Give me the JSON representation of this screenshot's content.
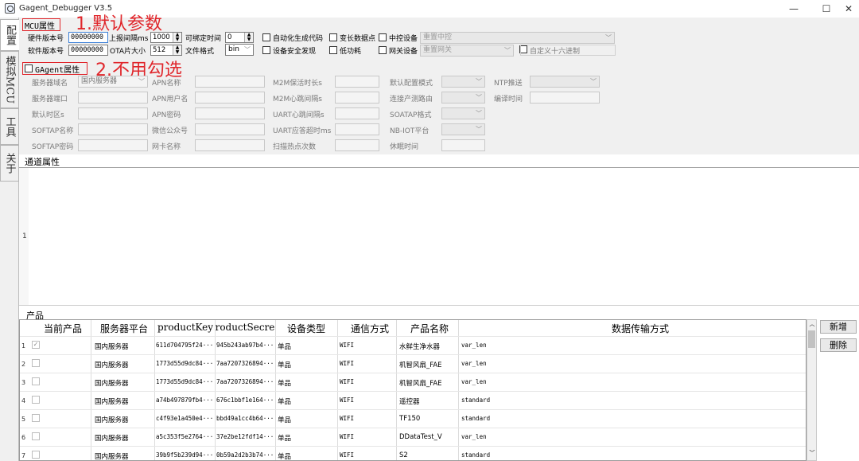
{
  "window": {
    "title": "Gagent_Debugger V3.5",
    "minimize_glyph": "—",
    "maximize_glyph": "☐",
    "close_glyph": "✕"
  },
  "sidebar_tabs": [
    "配置",
    "模拟MCU",
    "工具",
    "关于"
  ],
  "annotations": {
    "step1": "1.默认参数",
    "step2": "2.不用勾选"
  },
  "mcu": {
    "group_title": "MCU属性",
    "hw_version_label": "硬件版本号",
    "hw_version_value": "00000000",
    "sw_version_label": "软件版本号",
    "sw_version_value": "00000000",
    "report_interval_label": "上报间隔ms",
    "report_interval_value": "1000",
    "ota_size_label": "OTA片大小",
    "ota_size_value": "512",
    "bindable_time_label": "可绑定时间",
    "bindable_time_value": "0",
    "file_format_label": "文件格式",
    "file_format_value": "bin",
    "auto_code_label": "自动化生成代码",
    "var_datapoint_label": "变长数据点",
    "central_device_label": "中控设备",
    "central_device_combo": "重置中控",
    "secure_discovery_label": "设备安全发现",
    "low_power_label": "低功耗",
    "gateway_device_label": "网关设备",
    "gateway_combo": "重置网关",
    "custom_hex_label": "自定义十六进制"
  },
  "gagent": {
    "group_title": "GAgent属性",
    "server_domain_label": "服务器域名",
    "server_domain_value": "国内服务器",
    "server_port_label": "服务器端口",
    "default_tz_label": "默认时区s",
    "softap_name_label": "SOFTAP名称",
    "softap_pwd_label": "SOFTAP密码",
    "apn_name_label": "APN名称",
    "apn_user_label": "APN用户名",
    "apn_pwd_label": "APN密码",
    "wechat_label": "微信公众号",
    "netcard_label": "网卡名称",
    "m2m_keepalive_label": "M2M保活时长s",
    "m2m_heartbeat_label": "M2M心跳间隔s",
    "uart_heartbeat_label": "UART心跳间隔s",
    "uart_timeout_label": "UART应答超时ms",
    "scan_hotspot_label": "扫描热点次数",
    "default_mode_label": "默认配置模式",
    "connect_product_label": "连接产测路由",
    "softap_format_label": "SOATAP格式",
    "nbiot_label": "NB-IOT平台",
    "sleep_time_label": "休眠时间",
    "ntp_label": "NTP推送",
    "compile_time_label": "编译时间"
  },
  "channel": {
    "title": "通道属性",
    "line_number": "1"
  },
  "products": {
    "title": "产品",
    "columns": [
      "当前产品",
      "服务器平台",
      "productKey",
      "roductSecre",
      "设备类型",
      "通信方式",
      "产品名称",
      "数据传输方式"
    ],
    "rows": [
      {
        "num": "1",
        "checked": true,
        "platform": "国内服务器",
        "key": "611d704795f24···",
        "secret": "945b243ab97b4···",
        "type": "单品",
        "comm": "WIFI",
        "name": "水鲜生净水器",
        "transfer": "var_len"
      },
      {
        "num": "2",
        "checked": false,
        "platform": "国内服务器",
        "key": "1773d55d9dc84···",
        "secret": "7aa7207326894···",
        "type": "单品",
        "comm": "WIFI",
        "name": "机智风扇_FAE",
        "transfer": "var_len"
      },
      {
        "num": "3",
        "checked": false,
        "platform": "国内服务器",
        "key": "1773d55d9dc84···",
        "secret": "7aa7207326894···",
        "type": "单品",
        "comm": "WIFI",
        "name": "机智风扇_FAE",
        "transfer": "var_len"
      },
      {
        "num": "4",
        "checked": false,
        "platform": "国内服务器",
        "key": "a74b497879fb4···",
        "secret": "676c1bbf1e164···",
        "type": "单品",
        "comm": "WIFI",
        "name": "遥控器",
        "transfer": "standard"
      },
      {
        "num": "5",
        "checked": false,
        "platform": "国内服务器",
        "key": "c4f93e1a450e4···",
        "secret": "bbd49a1cc4b64···",
        "type": "单品",
        "comm": "WIFI",
        "name": "TF150",
        "transfer": "standard"
      },
      {
        "num": "6",
        "checked": false,
        "platform": "国内服务器",
        "key": "a5c353f5e2764···",
        "secret": "37e2be12fdf14···",
        "type": "单品",
        "comm": "WIFI",
        "name": "DDataTest_V",
        "transfer": "var_len"
      },
      {
        "num": "7",
        "checked": false,
        "platform": "国内服务器",
        "key": "39b9f5b239d94···",
        "secret": "0b59a2d2b3b74···",
        "type": "单品",
        "comm": "WIFI",
        "name": "S2",
        "transfer": "standard"
      }
    ],
    "add_button": "新增",
    "delete_button": "删除"
  },
  "colors": {
    "annotation_red": "#e0262b",
    "panel_bg": "#f0f0f0"
  }
}
